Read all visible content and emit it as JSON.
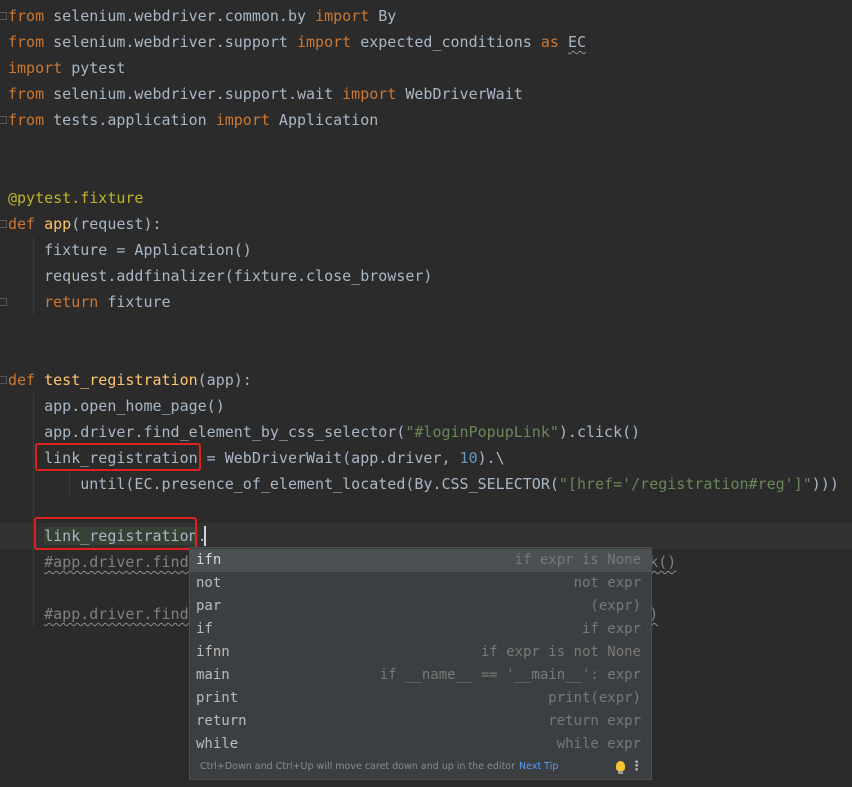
{
  "code_lines": [
    {
      "segments": [
        {
          "t": "from",
          "c": "kw"
        },
        {
          "t": " selenium.webdriver.common.by "
        },
        {
          "t": "import",
          "c": "kw"
        },
        {
          "t": " By"
        }
      ]
    },
    {
      "segments": [
        {
          "t": "from",
          "c": "kw"
        },
        {
          "t": " selenium.webdriver.support "
        },
        {
          "t": "import",
          "c": "kw"
        },
        {
          "t": " expected_conditions "
        },
        {
          "t": "as",
          "c": "kw"
        },
        {
          "t": " "
        },
        {
          "t": "EC",
          "c": "wavy"
        }
      ]
    },
    {
      "segments": [
        {
          "t": "import",
          "c": "kw"
        },
        {
          "t": " pytest"
        }
      ]
    },
    {
      "segments": [
        {
          "t": "from",
          "c": "kw"
        },
        {
          "t": " selenium.webdriver.support.wait "
        },
        {
          "t": "import",
          "c": "kw"
        },
        {
          "t": " WebDriverWait"
        }
      ]
    },
    {
      "segments": [
        {
          "t": "from",
          "c": "kw"
        },
        {
          "t": " tests.application "
        },
        {
          "t": "import",
          "c": "kw"
        },
        {
          "t": " Application"
        }
      ]
    },
    {
      "segments": []
    },
    {
      "segments": []
    },
    {
      "segments": [
        {
          "t": "@pytest.fixture",
          "c": "dec"
        }
      ]
    },
    {
      "segments": [
        {
          "t": "def",
          "c": "kw"
        },
        {
          "t": " "
        },
        {
          "t": "app",
          "c": "fn"
        },
        {
          "t": "(request):"
        }
      ]
    },
    {
      "segments": [
        {
          "t": "    fixture = Application()"
        }
      ]
    },
    {
      "segments": [
        {
          "t": "    request.addfinalizer(fixture.close_browser)"
        }
      ]
    },
    {
      "segments": [
        {
          "t": "    "
        },
        {
          "t": "return",
          "c": "kw"
        },
        {
          "t": " fixture"
        }
      ]
    },
    {
      "segments": []
    },
    {
      "segments": []
    },
    {
      "segments": [
        {
          "t": "def",
          "c": "kw"
        },
        {
          "t": " "
        },
        {
          "t": "test_registration",
          "c": "fn"
        },
        {
          "t": "(app):"
        }
      ]
    },
    {
      "segments": [
        {
          "t": "    app.open_home_page()"
        }
      ]
    },
    {
      "segments": [
        {
          "t": "    app.driver.find_element_by_css_selector("
        },
        {
          "t": "\"#loginPopupLink\"",
          "c": "str"
        },
        {
          "t": ").click()"
        }
      ]
    },
    {
      "segments": [
        {
          "t": "    link_registration = WebDriverWait(app.driver, "
        },
        {
          "t": "10",
          "c": "num"
        },
        {
          "t": ").\\"
        }
      ]
    },
    {
      "segments": [
        {
          "t": "        until(EC.presence_of_element_located(By.CSS_SELECTOR("
        },
        {
          "t": "\"[href='/registration#reg']\"",
          "c": "str"
        },
        {
          "t": ")))"
        }
      ]
    },
    {
      "segments": []
    },
    {
      "segments": [
        {
          "t": "    "
        },
        {
          "t": "link_registration",
          "c": "var"
        },
        {
          "t": "."
        }
      ]
    },
    {
      "segments": [
        {
          "t": "    "
        },
        {
          "t": "#app.driver.find",
          "c": "cmw"
        },
        {
          "t": "                                            "
        },
        {
          "t": "\").click()",
          "c": "cmw"
        }
      ]
    },
    {
      "segments": []
    },
    {
      "segments": [
        {
          "t": "    "
        },
        {
          "t": "#app.driver.find",
          "c": "cmw"
        },
        {
          "t": "                                            "
        },
        {
          "t": "аранин\")",
          "c": "cmw"
        }
      ]
    }
  ],
  "completion": {
    "items": [
      {
        "name": "ifn",
        "desc": "if expr is None"
      },
      {
        "name": "not",
        "desc": "not expr"
      },
      {
        "name": "par",
        "desc": "(expr)"
      },
      {
        "name": "if",
        "desc": "if expr"
      },
      {
        "name": "ifnn",
        "desc": "if expr is not None"
      },
      {
        "name": "main",
        "desc": "if __name__ == '__main__': expr"
      },
      {
        "name": "print",
        "desc": "print(expr)"
      },
      {
        "name": "return",
        "desc": "return expr"
      },
      {
        "name": "while",
        "desc": "while expr"
      }
    ],
    "selected_index": 0,
    "footer_tip": "Ctrl+Down and Ctrl+Up will move caret down and up in the editor",
    "footer_link": "Next Tip"
  },
  "colors": {
    "background": "#2b2b2b",
    "keyword": "#cc7832",
    "function": "#ffc66d",
    "string": "#6a8759",
    "highlight_box": "#e0201c"
  }
}
